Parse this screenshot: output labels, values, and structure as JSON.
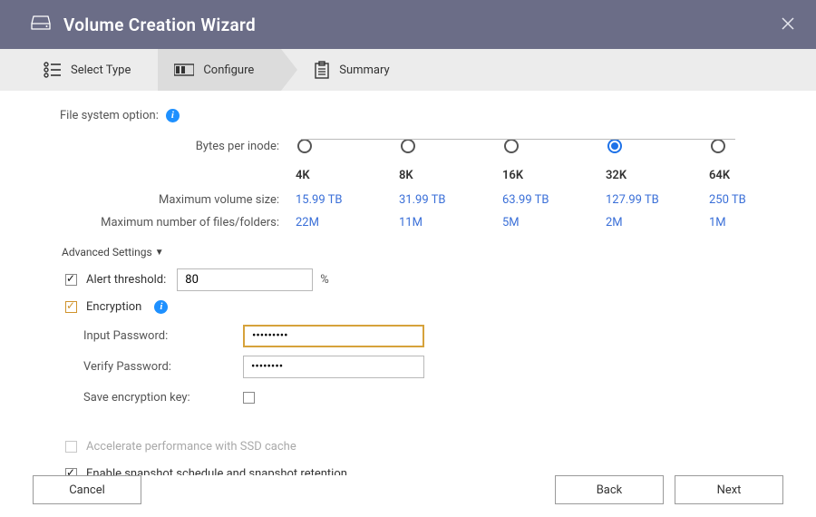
{
  "title": "Volume Creation Wizard",
  "steps": [
    {
      "label": "Select Type"
    },
    {
      "label": "Configure"
    },
    {
      "label": "Summary"
    }
  ],
  "fs_option_label": "File system option:",
  "bpi": {
    "row_label": "Bytes per inode:",
    "options": [
      "4K",
      "8K",
      "16K",
      "32K",
      "64K"
    ],
    "selected_index": 3,
    "max_vol_label": "Maximum volume size:",
    "max_vol": [
      "15.99 TB",
      "31.99 TB",
      "63.99 TB",
      "127.99 TB",
      "250 TB"
    ],
    "max_files_label": "Maximum number of files/folders:",
    "max_files": [
      "22M",
      "11M",
      "5M",
      "2M",
      "1M"
    ]
  },
  "advanced_label": "Advanced Settings",
  "alert": {
    "label": "Alert threshold:",
    "value": "80",
    "unit": "%"
  },
  "encryption": {
    "label": "Encryption",
    "input_pw_label": "Input Password:",
    "input_pw_value": "•••••••••",
    "verify_pw_label": "Verify Password:",
    "verify_pw_value": "••••••••",
    "save_key_label": "Save encryption key:"
  },
  "ssd_cache_label": "Accelerate performance with SSD cache",
  "snapshot_label": "Enable snapshot schedule and snapshot retention",
  "buttons": {
    "cancel": "Cancel",
    "back": "Back",
    "next": "Next"
  }
}
